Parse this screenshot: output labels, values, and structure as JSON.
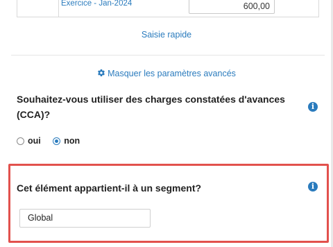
{
  "table_row": {
    "period": "Exercice - Jan-2024",
    "amount": "600,00"
  },
  "quick_entry_link": "Saisie rapide",
  "advanced_toggle": "Masquer les paramètres avancés",
  "cca_question": {
    "text": "Souhaitez-vous utiliser des charges constatées d'avances (CCA)?",
    "options": [
      "oui",
      "non"
    ],
    "selected": "non"
  },
  "segment_question": {
    "text": "Cet élément appartient-il à un segment?",
    "value": "Global"
  },
  "colors": {
    "accent": "#2a7bbd",
    "highlight": "#e2514d"
  },
  "icons": [
    "gear-icon",
    "info-icon"
  ]
}
